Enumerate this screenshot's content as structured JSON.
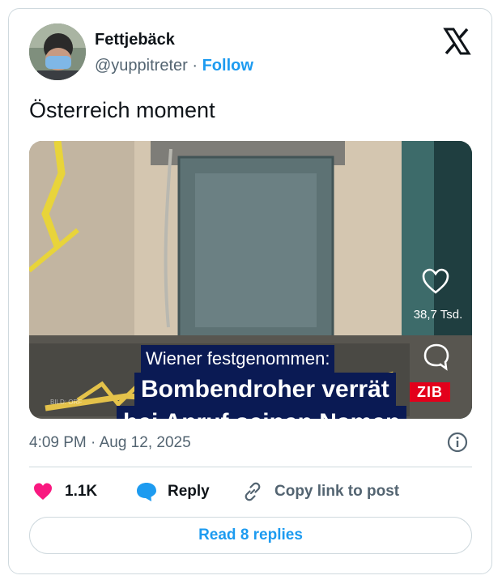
{
  "author": {
    "name": "Fettjebäck",
    "handle": "@yuppitreter",
    "separator": "·",
    "follow_label": "Follow"
  },
  "tweet": {
    "text": "Österreich moment",
    "timestamp": "4:09 PM · Aug 12, 2025"
  },
  "media": {
    "caption_line1": "Wiener festgenommen:",
    "caption_line2": "Bombendroher verrät",
    "caption_line3": "bei Anruf seinen Namen",
    "overlay_like_count": "38,7 Tsd.",
    "channel_logo": "ZIB",
    "watermark": "BILD: ORF"
  },
  "actions": {
    "like_count": "1.1K",
    "reply_label": "Reply",
    "copy_link_label": "Copy link to post"
  },
  "read_replies_label": "Read 8 replies",
  "colors": {
    "accent": "#1d9bf0",
    "like": "#f91880",
    "caption_bg": "#0a1a54",
    "zib_red": "#e3001b"
  },
  "icons": [
    "x-logo-icon",
    "info-icon",
    "heart-icon",
    "reply-bubble-icon",
    "link-icon"
  ]
}
